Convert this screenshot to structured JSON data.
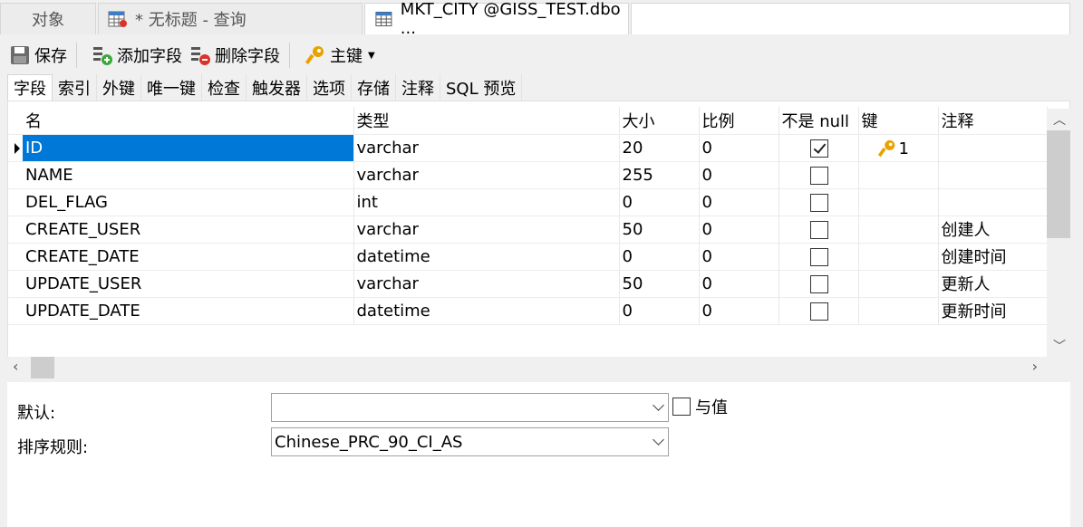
{
  "doc_tabs": {
    "objects": "对象",
    "query": "* 无标题 - 查询",
    "table": "MKT_CITY @GISS_TEST.dbo ..."
  },
  "toolbar": {
    "save": "保存",
    "add_field": "添加字段",
    "delete_field": "删除字段",
    "primary_key": "主键"
  },
  "sub_tabs": [
    "字段",
    "索引",
    "外键",
    "唯一键",
    "检查",
    "触发器",
    "选项",
    "存储",
    "注释",
    "SQL 预览"
  ],
  "fields": {
    "headers": [
      "名",
      "类型",
      "大小",
      "比例",
      "不是 null",
      "键",
      "注释"
    ],
    "rows": [
      {
        "name": "ID",
        "type": "varchar",
        "size": "20",
        "scale": "0",
        "not_null": true,
        "key": "1",
        "comment": ""
      },
      {
        "name": "NAME",
        "type": "varchar",
        "size": "255",
        "scale": "0",
        "not_null": false,
        "key": "",
        "comment": ""
      },
      {
        "name": "DEL_FLAG",
        "type": "int",
        "size": "0",
        "scale": "0",
        "not_null": false,
        "key": "",
        "comment": ""
      },
      {
        "name": "CREATE_USER",
        "type": "varchar",
        "size": "50",
        "scale": "0",
        "not_null": false,
        "key": "",
        "comment": "创建人"
      },
      {
        "name": "CREATE_DATE",
        "type": "datetime",
        "size": "0",
        "scale": "0",
        "not_null": false,
        "key": "",
        "comment": "创建时间"
      },
      {
        "name": "UPDATE_USER",
        "type": "varchar",
        "size": "50",
        "scale": "0",
        "not_null": false,
        "key": "",
        "comment": "更新人"
      },
      {
        "name": "UPDATE_DATE",
        "type": "datetime",
        "size": "0",
        "scale": "0",
        "not_null": false,
        "key": "",
        "comment": "更新时间"
      }
    ]
  },
  "properties": {
    "default_label": "默认:",
    "default_value": "",
    "with_value_label": "与值",
    "collation_label": "排序规则:",
    "collation_value": "Chinese_PRC_90_CI_AS"
  },
  "colors": {
    "selection": "#0078d7",
    "key_icon": "#e8a200",
    "add_icon": "#3aa83a",
    "delete_icon": "#d9332a"
  }
}
